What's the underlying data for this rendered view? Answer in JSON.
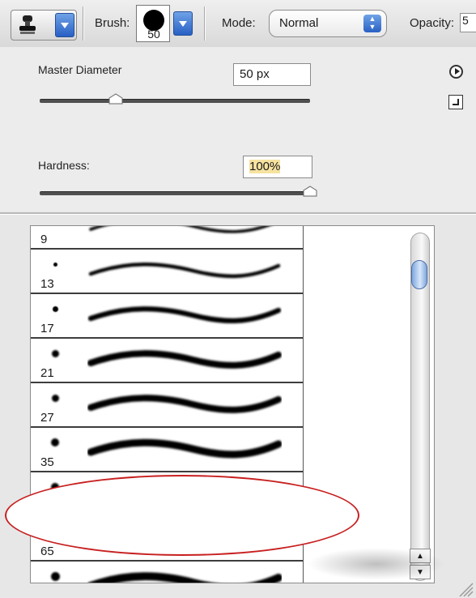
{
  "toolbar": {
    "tool_icon": "clone-stamp-icon",
    "brush_label": "Brush:",
    "brush_size": "50",
    "mode_label": "Mode:",
    "mode_value": "Normal",
    "opacity_label": "Opacity:",
    "opacity_value": "5"
  },
  "panel": {
    "master_diameter_label": "Master Diameter",
    "master_diameter_value": "50 px",
    "master_diameter_slider_level": 0.28,
    "hardness_label": "Hardness:",
    "hardness_value": "100%",
    "hardness_slider_level": 1.0,
    "menu_icon": "flyout-menu-icon",
    "new_preset_icon": "new-preset-icon"
  },
  "brush_list": {
    "items": [
      {
        "size": "9",
        "dot": 4
      },
      {
        "size": "13",
        "dot": 5
      },
      {
        "size": "17",
        "dot": 7
      },
      {
        "size": "21",
        "dot": 9
      },
      {
        "size": "27",
        "dot": 9
      },
      {
        "size": "35",
        "dot": 10
      },
      {
        "size": "",
        "dot": 10
      },
      {
        "size": "65",
        "dot": 0
      },
      {
        "size": "",
        "dot": 11
      }
    ]
  },
  "colors": {
    "accent": "#2860c4",
    "highlight": "#f6e3a0",
    "annotation": "#c82020"
  }
}
